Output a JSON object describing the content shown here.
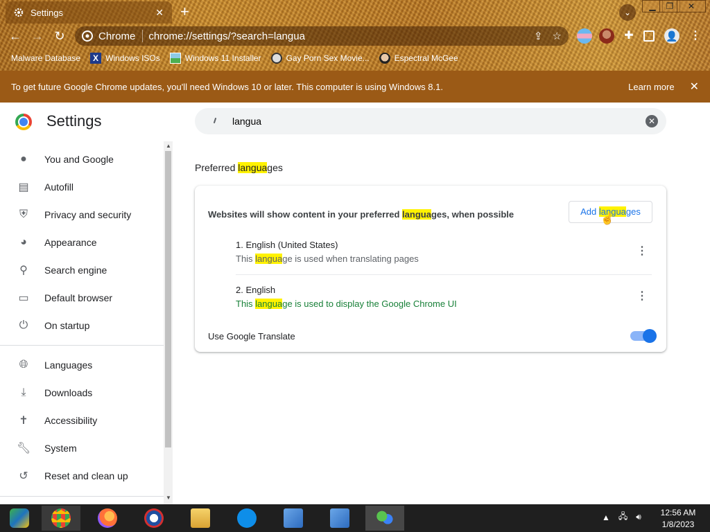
{
  "browser": {
    "tab": {
      "title": "Settings",
      "icon": "gear-icon",
      "close": "✕"
    },
    "new_tab": "+",
    "window_controls": {
      "minimize": "▁",
      "maximize": "❐",
      "close": "✕"
    },
    "omnibox": {
      "site_name": "Chrome",
      "url": "chrome://settings/?search=langua"
    },
    "bookmarks": [
      {
        "label": "Malware Database",
        "icon": "malware-icon"
      },
      {
        "label": "Windows ISOs",
        "icon": "x-icon"
      },
      {
        "label": "Windows 11 Installer",
        "icon": "image-icon"
      },
      {
        "label": "Gay Porn Sex Movie...",
        "icon": "globe-icon"
      },
      {
        "label": "Espectral McGee",
        "icon": "face-icon"
      }
    ],
    "infobar": {
      "message": "To get future Google Chrome updates, you'll need Windows 10 or later. This computer is using Windows 8.1.",
      "link": "Learn more",
      "close": "✕"
    }
  },
  "settings": {
    "title": "Settings",
    "search": {
      "value": "langua"
    },
    "sidebar": [
      {
        "label": "You and Google",
        "icon": "person-icon"
      },
      {
        "label": "Autofill",
        "icon": "clipboard-icon"
      },
      {
        "label": "Privacy and security",
        "icon": "shield-icon"
      },
      {
        "label": "Appearance",
        "icon": "palette-icon"
      },
      {
        "label": "Search engine",
        "icon": "search-icon"
      },
      {
        "label": "Default browser",
        "icon": "browser-icon"
      },
      {
        "label": "On startup",
        "icon": "power-icon"
      },
      {
        "label": "Languages",
        "icon": "globe-icon"
      },
      {
        "label": "Downloads",
        "icon": "download-icon"
      },
      {
        "label": "Accessibility",
        "icon": "accessibility-icon"
      },
      {
        "label": "System",
        "icon": "wrench-icon"
      },
      {
        "label": "Reset and clean up",
        "icon": "reset-icon"
      }
    ],
    "section": {
      "title_pre": "Preferred ",
      "title_hl": "langua",
      "title_post": "ges",
      "desc_pre": "Websites will show content in your preferred ",
      "desc_hl": "langua",
      "desc_post": "ges, when possible",
      "add_pre": "Add ",
      "add_hl": "langua",
      "add_post": "ges",
      "languages": [
        {
          "name": "1. English (United States)",
          "sub_pre": "This ",
          "sub_hl": "langua",
          "sub_post": "ge is used when translating pages"
        },
        {
          "name": "2. English",
          "sub_pre": "This ",
          "sub_hl": "langua",
          "sub_post": "ge is used to display the Google Chrome UI"
        }
      ],
      "translate_label": "Use Google Translate",
      "translate_enabled": true
    }
  },
  "taskbar": {
    "clock_time": "12:56 AM",
    "clock_date": "1/8/2023"
  },
  "colors": {
    "accent": "#1a73e8",
    "highlight": "#fff200",
    "infobar": "#9b5a16",
    "green_text": "#188038"
  }
}
